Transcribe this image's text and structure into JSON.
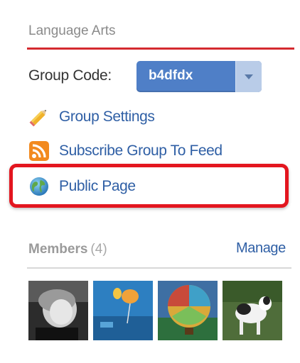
{
  "group": {
    "title": "Language Arts",
    "code_label": "Group Code:",
    "code_value": "b4dfdx"
  },
  "links": [
    {
      "label": "Group Settings",
      "icon": "pencil-icon"
    },
    {
      "label": "Subscribe Group To Feed",
      "icon": "rss-feed-icon"
    },
    {
      "label": "Public Page",
      "icon": "globe-icon"
    }
  ],
  "members": {
    "label": "Members",
    "count": "(4)",
    "manage_label": "Manage",
    "avatars": [
      "member-avatar-1",
      "member-avatar-2",
      "member-avatar-3",
      "member-avatar-4"
    ]
  },
  "colors": {
    "accent_rule": "#d42a2f",
    "highlight": "#e3161f",
    "link": "#2f5fa5",
    "code_button": "#4f7fc7"
  }
}
